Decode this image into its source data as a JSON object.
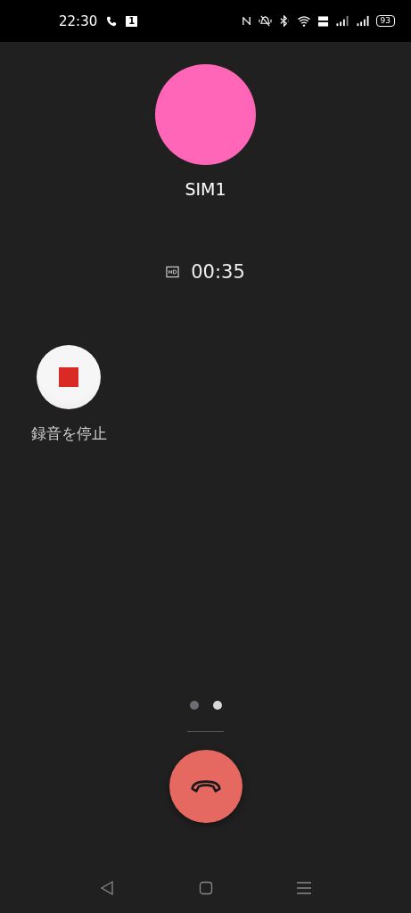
{
  "status_bar": {
    "time": "22:30",
    "sim_badge": "1",
    "battery": "93"
  },
  "caller": {
    "name": "SIM1"
  },
  "call": {
    "hd": true,
    "duration": "00:35"
  },
  "actions": [
    {
      "kind": "stop_record",
      "label": "録音を停止"
    }
  ],
  "page_dots": [
    {
      "selected": false
    },
    {
      "selected": true
    }
  ]
}
